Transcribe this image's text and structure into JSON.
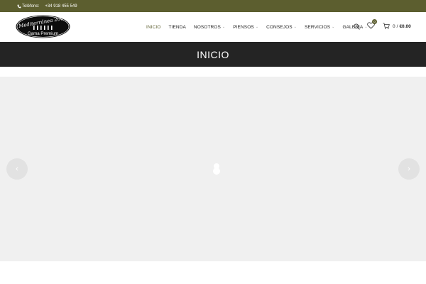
{
  "topbar": {
    "phone_label": "Teléfono:",
    "phone_number": "+34 918 455 549",
    "icon": "phone-icon"
  },
  "header": {
    "logo": {
      "line1": "Mediterránea 2000",
      "line2": "Gama Premium"
    },
    "nav": [
      {
        "label": "INICIO",
        "active": true,
        "has_dropdown": false
      },
      {
        "label": "TIENDA",
        "active": false,
        "has_dropdown": false
      },
      {
        "label": "NOSOTROS",
        "active": false,
        "has_dropdown": true
      },
      {
        "label": "PIENSOS",
        "active": false,
        "has_dropdown": true
      },
      {
        "label": "CONSEJOS",
        "active": false,
        "has_dropdown": true
      },
      {
        "label": "SERVICIOS",
        "active": false,
        "has_dropdown": true
      },
      {
        "label": "GALERIA",
        "active": false,
        "has_dropdown": true
      }
    ],
    "wishlist_count": "0",
    "cart": {
      "count": "0",
      "separator": "/",
      "total": "€0.00"
    }
  },
  "banner": {
    "title": "INICIO"
  },
  "slider": {
    "prev_icon": "chevron-left-icon",
    "next_icon": "chevron-right-icon"
  },
  "colors": {
    "accent": "#5c5e2f",
    "banner_bg": "#242424",
    "slider_bg": "#f0f0f0"
  }
}
